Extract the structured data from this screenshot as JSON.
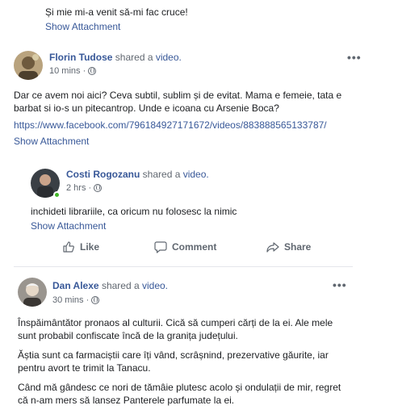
{
  "top_comment": {
    "text": "Și mie mi-a venit să-mi fac cruce!",
    "attachment_link": "Show Attachment"
  },
  "post1": {
    "author": "Florin Tudose",
    "action_text": "shared a",
    "action_object": "video.",
    "time": "10 mins ·",
    "text": "Dar ce avem noi aici? Ceva subtil, sublim și de evitat. Mama e femeie, tata e barbat si io-s un pitecantrop. Unde e icoana cu Arsenie Boca?",
    "url": "https://www.facebook.com/796184927171672/videos/883888565133787/",
    "attachment_link": "Show Attachment",
    "menu": "•••"
  },
  "reply1": {
    "author": "Costi Rogozanu",
    "action_text": "shared a",
    "action_object": "video.",
    "time": "2 hrs ·",
    "text": "inchideti librariile, ca oricum nu folosesc la nimic",
    "attachment_link": "Show Attachment"
  },
  "actions": {
    "like": "Like",
    "comment": "Comment",
    "share": "Share"
  },
  "post2": {
    "author": "Dan Alexe",
    "action_text": "shared a",
    "action_object": "video.",
    "time": "30 mins ·",
    "paragraphs": [
      "Înspăimântător pronaos al culturii. Cică să cumperi cărți de la ei. Ale mele sunt probabil confiscate încă de la granița județului.",
      "Ăștia sunt ca farmaciștii care îți vând, scrâșnind, prezervative găurite, iar pentru avort te trimit la Tanacu.",
      "Când mă gândesc ce nori de tămâie plutesc acolo și ondulații de mir, regret că n-am mers să lansez Panterele parfumate la ei."
    ],
    "menu": "•••"
  },
  "colors": {
    "link": "#385898",
    "muted": "#606770",
    "text": "#1c1e21",
    "online": "#42b72a"
  }
}
